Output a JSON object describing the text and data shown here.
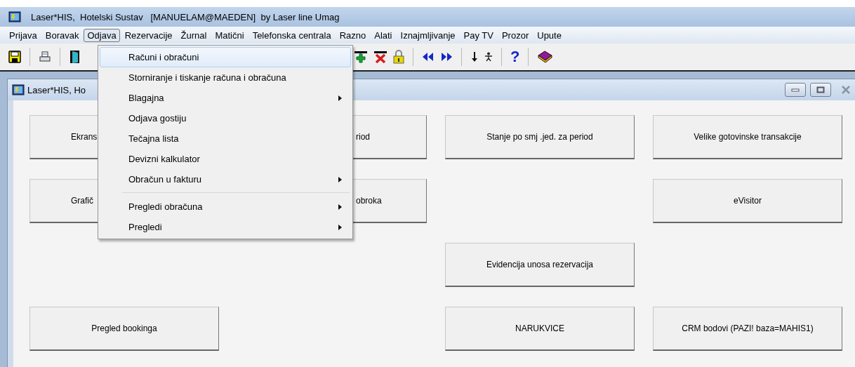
{
  "window": {
    "title": "Laser*HIS,  Hotelski Sustav   [MANUELAM@MAEDEN]  by Laser line Umag"
  },
  "menu_bar": [
    {
      "label": "Prijava",
      "selected": false
    },
    {
      "label": "Boravak",
      "selected": false
    },
    {
      "label": "Odjava",
      "selected": true
    },
    {
      "label": "Rezervacije",
      "selected": false
    },
    {
      "label": "Žurnal",
      "selected": false
    },
    {
      "label": "Matični",
      "selected": false
    },
    {
      "label": "Telefonska centrala",
      "selected": false
    },
    {
      "label": "Razno",
      "selected": false
    },
    {
      "label": "Alati",
      "selected": false
    },
    {
      "label": "Iznajmljivanje",
      "selected": false
    },
    {
      "label": "Pay TV",
      "selected": false
    },
    {
      "label": "Prozor",
      "selected": false
    },
    {
      "label": "Upute",
      "selected": false
    }
  ],
  "toolbar": {
    "help_label": "?"
  },
  "dropdown": [
    {
      "kind": "item",
      "label": "Računi i obračuni",
      "selected": true,
      "submenu": false
    },
    {
      "kind": "item",
      "label": "Storniranje i tiskanje računa i obračuna",
      "selected": false,
      "submenu": false
    },
    {
      "kind": "item",
      "label": "Blagajna",
      "selected": false,
      "submenu": true
    },
    {
      "kind": "item",
      "label": "Odjava gostiju",
      "selected": false,
      "submenu": false
    },
    {
      "kind": "item",
      "label": "Tečajna lista",
      "selected": false,
      "submenu": false
    },
    {
      "kind": "item",
      "label": "Devizni kalkulator",
      "selected": false,
      "submenu": false
    },
    {
      "kind": "item",
      "label": "Obračun u fakturu",
      "selected": false,
      "submenu": true
    },
    {
      "kind": "separator"
    },
    {
      "kind": "item",
      "label": "Pregledi obračuna",
      "selected": false,
      "submenu": true
    },
    {
      "kind": "item",
      "label": "Pregledi",
      "selected": false,
      "submenu": true
    }
  ],
  "child_window": {
    "title": "Laser*HIS, Ho",
    "buttons": [
      {
        "kind": "cut_right",
        "label": "Ekrans"
      },
      {
        "kind": "cut_left",
        "label": "riod"
      },
      {
        "kind": "button",
        "label": "Stanje po smj .jed. za period"
      },
      {
        "kind": "button",
        "label": "Velike gotovinske transakcije"
      },
      {
        "kind": "cut_right",
        "label": "Grafič"
      },
      {
        "kind": "cut_left",
        "label": "obroka"
      },
      {
        "kind": "empty"
      },
      {
        "kind": "button",
        "label": "eVisitor"
      },
      {
        "kind": "empty"
      },
      {
        "kind": "empty"
      },
      {
        "kind": "button",
        "label": "Evidencija unosa rezervacija"
      },
      {
        "kind": "empty"
      },
      {
        "kind": "button",
        "label": "Pregled bookinga"
      },
      {
        "kind": "empty"
      },
      {
        "kind": "button",
        "label": "NARUKVICE"
      },
      {
        "kind": "button",
        "label": "CRM bodovi (PAZI! baza=MAHIS1)"
      }
    ]
  }
}
